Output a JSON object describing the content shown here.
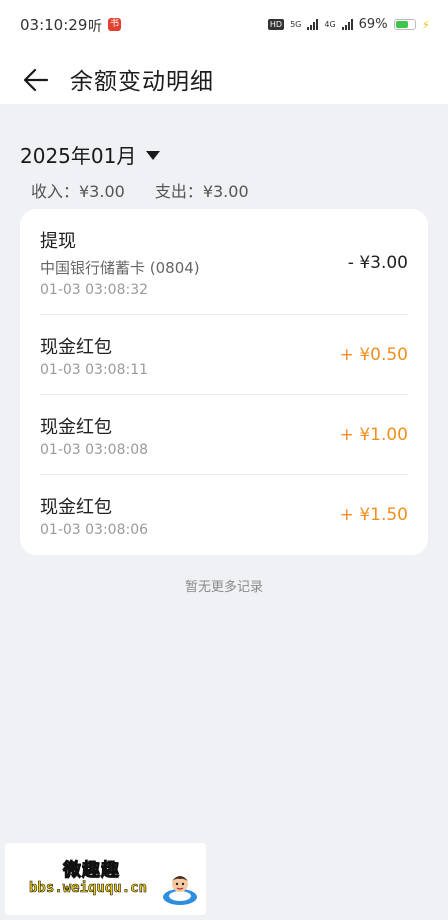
{
  "status_bar": {
    "time": "03:10:29",
    "listen_label": "听",
    "app_badge": "书",
    "hd_label": "HD",
    "sim1_label": "5G",
    "sim2_label": "4G",
    "battery_percent": "69%",
    "battery_level": 0.69
  },
  "header": {
    "title": "余额变动明细",
    "back_icon": "arrow-left-icon"
  },
  "filter": {
    "month": "2025年01月"
  },
  "summary": {
    "income": "收入：¥3.00",
    "expense": "支出：¥3.00"
  },
  "transactions": [
    {
      "title": "提现",
      "subtitle": "中国银行储蓄卡 (0804)",
      "time": "01-03 03:08:32",
      "amount": "- ¥3.00",
      "type": "expense"
    },
    {
      "title": "现金红包",
      "time": "01-03 03:08:11",
      "amount": "+ ¥0.50",
      "type": "income"
    },
    {
      "title": "现金红包",
      "time": "01-03 03:08:08",
      "amount": "+ ¥1.00",
      "type": "income"
    },
    {
      "title": "现金红包",
      "time": "01-03 03:08:06",
      "amount": "+ ¥1.50",
      "type": "income"
    }
  ],
  "footer_note": "暂无更多记录",
  "watermark": {
    "title": "微趣趣",
    "url": "bbs.weiququ.cn"
  },
  "colors": {
    "income": "#f0901e",
    "expense": "#1f1f1f",
    "background": "#f0f1f5"
  }
}
